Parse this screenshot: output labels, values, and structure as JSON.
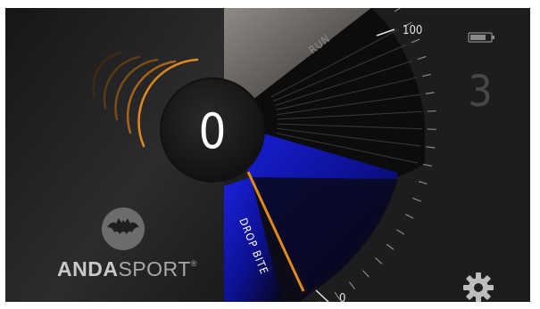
{
  "gauge": {
    "max_label": "100",
    "min_label": "0",
    "value_fraction": 0.0
  },
  "center_display": {
    "value": "0"
  },
  "modes": {
    "upper": "RUN",
    "lower": "DROP BITE"
  },
  "level": {
    "value": "3"
  },
  "brand": {
    "part1": "ANDA",
    "part2": "SPORT",
    "reg": "®"
  },
  "icons": {
    "logo": "bat-logo-icon",
    "settings": "gear-icon",
    "battery": "battery-icon",
    "signal": "sound-wave-icon"
  },
  "colors": {
    "accent_orange": "#e08a1e",
    "drop_blue": "#1a22d8",
    "background": "#1f1f21"
  }
}
